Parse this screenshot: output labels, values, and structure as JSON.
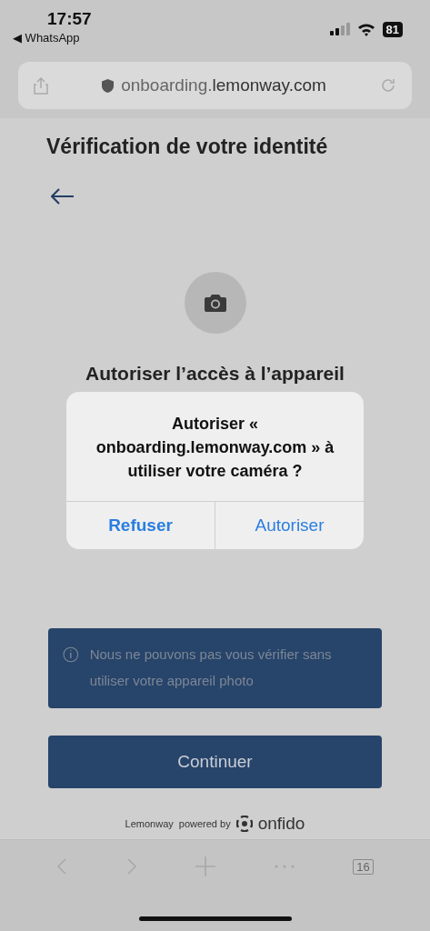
{
  "status_bar": {
    "time": "17:57",
    "back_app": "◀ WhatsApp",
    "battery": "81"
  },
  "browser": {
    "url_domain": "onboarding.",
    "url_rest": "lemonway.com",
    "tab_count": "16"
  },
  "page": {
    "title": "Vérification de votre identité",
    "heading": "Autoriser l’accès à l’appareil",
    "info": "Nous ne pouvons pas vous vérifier sans utiliser votre appareil photo",
    "button": "Continuer",
    "brand": "Lemonway",
    "powered_by": "powered by",
    "provider": "onfido"
  },
  "dialog": {
    "title": "Autoriser « onboarding.lemonway.com » à utiliser votre caméra ?",
    "buttons": [
      {
        "label": "Refuser",
        "primary": true
      },
      {
        "label": "Autoriser",
        "primary": false
      }
    ]
  }
}
